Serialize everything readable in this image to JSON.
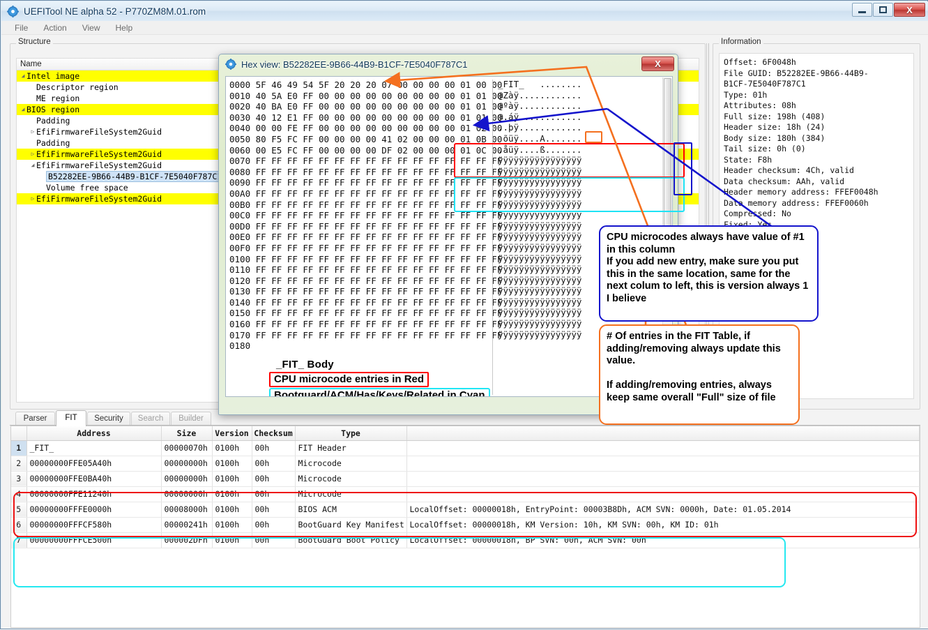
{
  "window": {
    "title": "UEFITool NE alpha 52 - P770ZM8M.01.rom",
    "app_icon": "gear-icon",
    "minimize_label": "",
    "maximize_label": "",
    "close_label": "X"
  },
  "menubar": {
    "items": [
      "File",
      "Action",
      "View",
      "Help"
    ]
  },
  "structure": {
    "group_title": "Structure",
    "column_header": "Name",
    "rows": [
      {
        "label": "Intel image",
        "indent": 0,
        "twig": "◢",
        "highlight": true,
        "selected": false
      },
      {
        "label": "Descriptor region",
        "indent": 1,
        "twig": "",
        "highlight": false,
        "selected": false
      },
      {
        "label": "ME region",
        "indent": 1,
        "twig": "",
        "highlight": false,
        "selected": false
      },
      {
        "label": "BIOS region",
        "indent": 0,
        "twig": "◢",
        "highlight": true,
        "selected": false
      },
      {
        "label": "Padding",
        "indent": 1,
        "twig": "",
        "highlight": false,
        "selected": false
      },
      {
        "label": "EfiFirmwareFileSystem2Guid",
        "indent": 1,
        "twig": "▷",
        "highlight": false,
        "selected": false
      },
      {
        "label": "Padding",
        "indent": 1,
        "twig": "",
        "highlight": false,
        "selected": false
      },
      {
        "label": "EfiFirmwareFileSystem2Guid",
        "indent": 1,
        "twig": "▷",
        "highlight": true,
        "selected": false
      },
      {
        "label": "EfiFirmwareFileSystem2Guid",
        "indent": 1,
        "twig": "◢",
        "highlight": false,
        "selected": false
      },
      {
        "label": "B52282EE-9B66-44B9-B1CF-7E5040F787C1",
        "indent": 2,
        "twig": "",
        "highlight": false,
        "selected": true
      },
      {
        "label": "Volume free space",
        "indent": 2,
        "twig": "",
        "highlight": false,
        "selected": false
      },
      {
        "label": "EfiFirmwareFileSystem2Guid",
        "indent": 1,
        "twig": "▷",
        "highlight": true,
        "selected": false
      }
    ]
  },
  "information": {
    "group_title": "Information",
    "lines": [
      "Offset: 6F0048h",
      "File GUID: B52282EE-9B66-44B9-",
      "B1CF-7E5040F787C1",
      "Type: 01h",
      "Attributes: 08h",
      "Full size: 198h (408)",
      "Header size: 18h (24)",
      "Body size: 180h (384)",
      "Tail size: 0h (0)",
      "State: F8h",
      "Header checksum: 4Ch, valid",
      "Data checksum: AAh, valid",
      "Header memory address: FFEF0048h",
      "Data memory address: FFEF0060h",
      "Compressed: No",
      "Fixed: Yes"
    ]
  },
  "tabs": [
    {
      "label": "Parser",
      "active": false,
      "disabled": false
    },
    {
      "label": "FIT",
      "active": true,
      "disabled": false
    },
    {
      "label": "Security",
      "active": false,
      "disabled": false
    },
    {
      "label": "Search",
      "active": false,
      "disabled": true
    },
    {
      "label": "Builder",
      "active": false,
      "disabled": true
    }
  ],
  "fit_table": {
    "headers": [
      "",
      "Address",
      "Size",
      "Version",
      "Checksum",
      "Type",
      ""
    ],
    "rows": [
      {
        "n": "1",
        "address": "_FIT_",
        "size": "00000070h",
        "version": "0100h",
        "checksum": "00h",
        "type": "FIT Header",
        "details": ""
      },
      {
        "n": "2",
        "address": "00000000FFE05A40h",
        "size": "00000000h",
        "version": "0100h",
        "checksum": "00h",
        "type": "Microcode",
        "details": ""
      },
      {
        "n": "3",
        "address": "00000000FFE0BA40h",
        "size": "00000000h",
        "version": "0100h",
        "checksum": "00h",
        "type": "Microcode",
        "details": ""
      },
      {
        "n": "4",
        "address": "00000000FFE11240h",
        "size": "00000000h",
        "version": "0100h",
        "checksum": "00h",
        "type": "Microcode",
        "details": ""
      },
      {
        "n": "5",
        "address": "00000000FFFE0000h",
        "size": "00008000h",
        "version": "0100h",
        "checksum": "00h",
        "type": "BIOS ACM",
        "details": "LocalOffset: 00000018h, EntryPoint: 00003B8Dh, ACM SVN: 0000h, Date: 01.05.2014"
      },
      {
        "n": "6",
        "address": "00000000FFFCF580h",
        "size": "00000241h",
        "version": "0100h",
        "checksum": "00h",
        "type": "BootGuard Key Manifest",
        "details": "LocalOffset: 00000018h, KM Version: 10h, KM SVN: 00h, KM ID: 01h"
      },
      {
        "n": "7",
        "address": "00000000FFFCE500h",
        "size": "000002DFh",
        "version": "0100h",
        "checksum": "00h",
        "type": "BootGuard Boot Policy",
        "details": "LocalOffset: 00000018h, BP SVN: 00h, ACM SVN: 00h"
      }
    ]
  },
  "hex_dialog": {
    "title": "Hex view: B52282EE-9B66-44B9-B1CF-7E5040F787C1",
    "icon": "gear-icon",
    "close_label": "X",
    "rows": [
      {
        "offset": "0000",
        "bytes": "5F 46 49 54 5F 20 20 20 07 00 00 00 00 01 00 00",
        "ascii": "_FIT_   ........"
      },
      {
        "offset": "0010",
        "bytes": "40 5A E0 FF 00 00 00 00 00 00 00 00 00 01 01 00",
        "ascii": "@Zàÿ............"
      },
      {
        "offset": "0020",
        "bytes": "40 BA E0 FF 00 00 00 00 00 00 00 00 00 01 01 00",
        "ascii": "@ºàÿ............"
      },
      {
        "offset": "0030",
        "bytes": "40 12 E1 FF 00 00 00 00 00 00 00 00 00 01 01 00",
        "ascii": "@.áÿ............"
      },
      {
        "offset": "0040",
        "bytes": "00 00 FE FF 00 00 00 00 00 00 00 00 00 01 02 00",
        "ascii": "..þÿ............"
      },
      {
        "offset": "0050",
        "bytes": "80 F5 FC FF 00 00 00 00 41 02 00 00 00 01 0B 00",
        "ascii": " õüÿ....A......."
      },
      {
        "offset": "0060",
        "bytes": "00 E5 FC FF 00 00 00 00 DF 02 00 00 00 01 0C 00",
        "ascii": ".åüÿ....ß......."
      },
      {
        "offset": "0070",
        "bytes": "FF FF FF FF FF FF FF FF FF FF FF FF FF FF FF FF",
        "ascii": "ÿÿÿÿÿÿÿÿÿÿÿÿÿÿÿÿ"
      },
      {
        "offset": "0080",
        "bytes": "FF FF FF FF FF FF FF FF FF FF FF FF FF FF FF FF",
        "ascii": "ÿÿÿÿÿÿÿÿÿÿÿÿÿÿÿÿ"
      },
      {
        "offset": "0090",
        "bytes": "FF FF FF FF FF FF FF FF FF FF FF FF FF FF FF FF",
        "ascii": "ÿÿÿÿÿÿÿÿÿÿÿÿÿÿÿÿ"
      },
      {
        "offset": "00A0",
        "bytes": "FF FF FF FF FF FF FF FF FF FF FF FF FF FF FF FF",
        "ascii": "ÿÿÿÿÿÿÿÿÿÿÿÿÿÿÿÿ"
      },
      {
        "offset": "00B0",
        "bytes": "FF FF FF FF FF FF FF FF FF FF FF FF FF FF FF FF",
        "ascii": "ÿÿÿÿÿÿÿÿÿÿÿÿÿÿÿÿ"
      },
      {
        "offset": "00C0",
        "bytes": "FF FF FF FF FF FF FF FF FF FF FF FF FF FF FF FF",
        "ascii": "ÿÿÿÿÿÿÿÿÿÿÿÿÿÿÿÿ"
      },
      {
        "offset": "00D0",
        "bytes": "FF FF FF FF FF FF FF FF FF FF FF FF FF FF FF FF",
        "ascii": "ÿÿÿÿÿÿÿÿÿÿÿÿÿÿÿÿ"
      },
      {
        "offset": "00E0",
        "bytes": "FF FF FF FF FF FF FF FF FF FF FF FF FF FF FF FF",
        "ascii": "ÿÿÿÿÿÿÿÿÿÿÿÿÿÿÿÿ"
      },
      {
        "offset": "00F0",
        "bytes": "FF FF FF FF FF FF FF FF FF FF FF FF FF FF FF FF",
        "ascii": "ÿÿÿÿÿÿÿÿÿÿÿÿÿÿÿÿ"
      },
      {
        "offset": "0100",
        "bytes": "FF FF FF FF FF FF FF FF FF FF FF FF FF FF FF FF",
        "ascii": "ÿÿÿÿÿÿÿÿÿÿÿÿÿÿÿÿ"
      },
      {
        "offset": "0110",
        "bytes": "FF FF FF FF FF FF FF FF FF FF FF FF FF FF FF FF",
        "ascii": "ÿÿÿÿÿÿÿÿÿÿÿÿÿÿÿÿ"
      },
      {
        "offset": "0120",
        "bytes": "FF FF FF FF FF FF FF FF FF FF FF FF FF FF FF FF",
        "ascii": "ÿÿÿÿÿÿÿÿÿÿÿÿÿÿÿÿ"
      },
      {
        "offset": "0130",
        "bytes": "FF FF FF FF FF FF FF FF FF FF FF FF FF FF FF FF",
        "ascii": "ÿÿÿÿÿÿÿÿÿÿÿÿÿÿÿÿ"
      },
      {
        "offset": "0140",
        "bytes": "FF FF FF FF FF FF FF FF FF FF FF FF FF FF FF FF",
        "ascii": "ÿÿÿÿÿÿÿÿÿÿÿÿÿÿÿÿ"
      },
      {
        "offset": "0150",
        "bytes": "FF FF FF FF FF FF FF FF FF FF FF FF FF FF FF FF",
        "ascii": "ÿÿÿÿÿÿÿÿÿÿÿÿÿÿÿÿ"
      },
      {
        "offset": "0160",
        "bytes": "FF FF FF FF FF FF FF FF FF FF FF FF FF FF FF FF",
        "ascii": "ÿÿÿÿÿÿÿÿÿÿÿÿÿÿÿÿ"
      },
      {
        "offset": "0170",
        "bytes": "FF FF FF FF FF FF FF FF FF FF FF FF FF FF FF FF",
        "ascii": "ÿÿÿÿÿÿÿÿÿÿÿÿÿÿÿÿ"
      },
      {
        "offset": "0180",
        "bytes": "",
        "ascii": ""
      }
    ],
    "inline_notes": {
      "body_label": "_FIT_ Body",
      "red_label": "CPU microcode entries in Red",
      "cyan_label": "Bootguard/ACM/Has/Keys/Related in Cyan"
    }
  },
  "annotations": {
    "blue_note": "CPU microcodes always have value of #1 in this column\nIf you add new entry, make sure you put this in the same location, same for the next colum to left, this is version always 1 I believe",
    "orange_note": "# Of entries in the FIT Table, if adding/removing always update this value.\n\nIf adding/removing entries, always keep same overall \"Full\" size of file"
  },
  "colors": {
    "red": "#ff0000",
    "cyan": "#20e6f5",
    "orange": "#f4701f",
    "blue": "#1414cc",
    "highlight_yellow": "#ffff00",
    "selection_blue": "#cfe3f7"
  }
}
